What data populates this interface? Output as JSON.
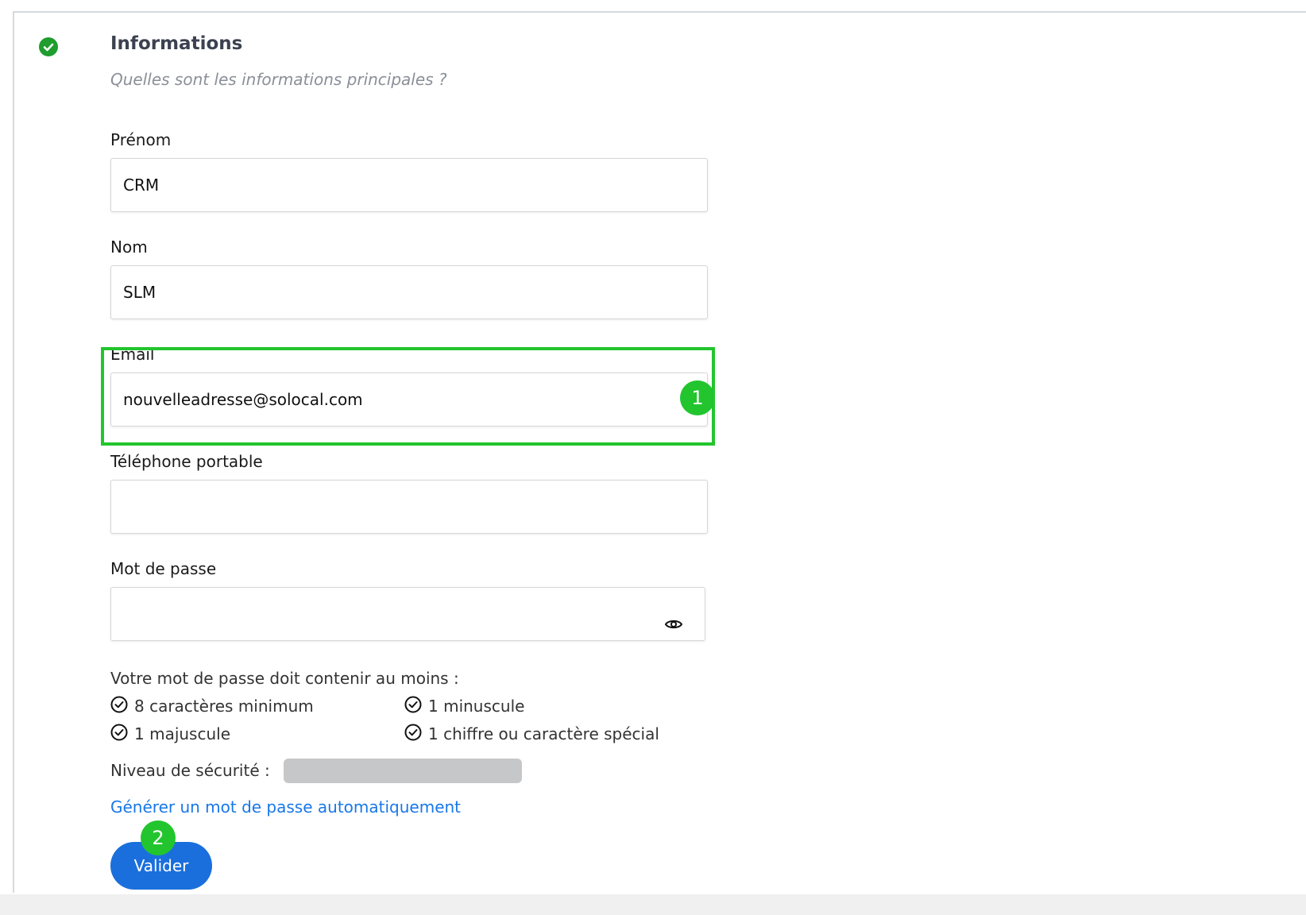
{
  "section": {
    "title": "Informations",
    "subtitle": "Quelles sont les informations principales ?",
    "status_icon": "check-circle-icon",
    "status_color": "#1f9d2e"
  },
  "fields": {
    "prenom": {
      "label": "Prénom",
      "value": "CRM"
    },
    "nom": {
      "label": "Nom",
      "value": "SLM"
    },
    "email": {
      "label": "Email",
      "value": "nouvelleadresse@solocal.com"
    },
    "telephone": {
      "label": "Téléphone portable",
      "value": ""
    },
    "password": {
      "label": "Mot de passe",
      "value": "",
      "toggle_icon": "eye-icon"
    }
  },
  "password_rules": {
    "intro": "Votre mot de passe doit contenir au moins :",
    "items": [
      "8 caractères minimum",
      "1 minuscule",
      "1 majuscule",
      "1 chiffre ou caractère spécial"
    ]
  },
  "security": {
    "label": "Niveau de sécurité :",
    "level": 0
  },
  "generate_link": "Générer un mot de passe automatiquement",
  "submit_label": "Valider",
  "annotations": {
    "badge_1": "1",
    "badge_2": "2",
    "highlight_color": "#22c52e"
  },
  "colors": {
    "link": "#1877e8",
    "primary_button": "#1a6fdc"
  }
}
